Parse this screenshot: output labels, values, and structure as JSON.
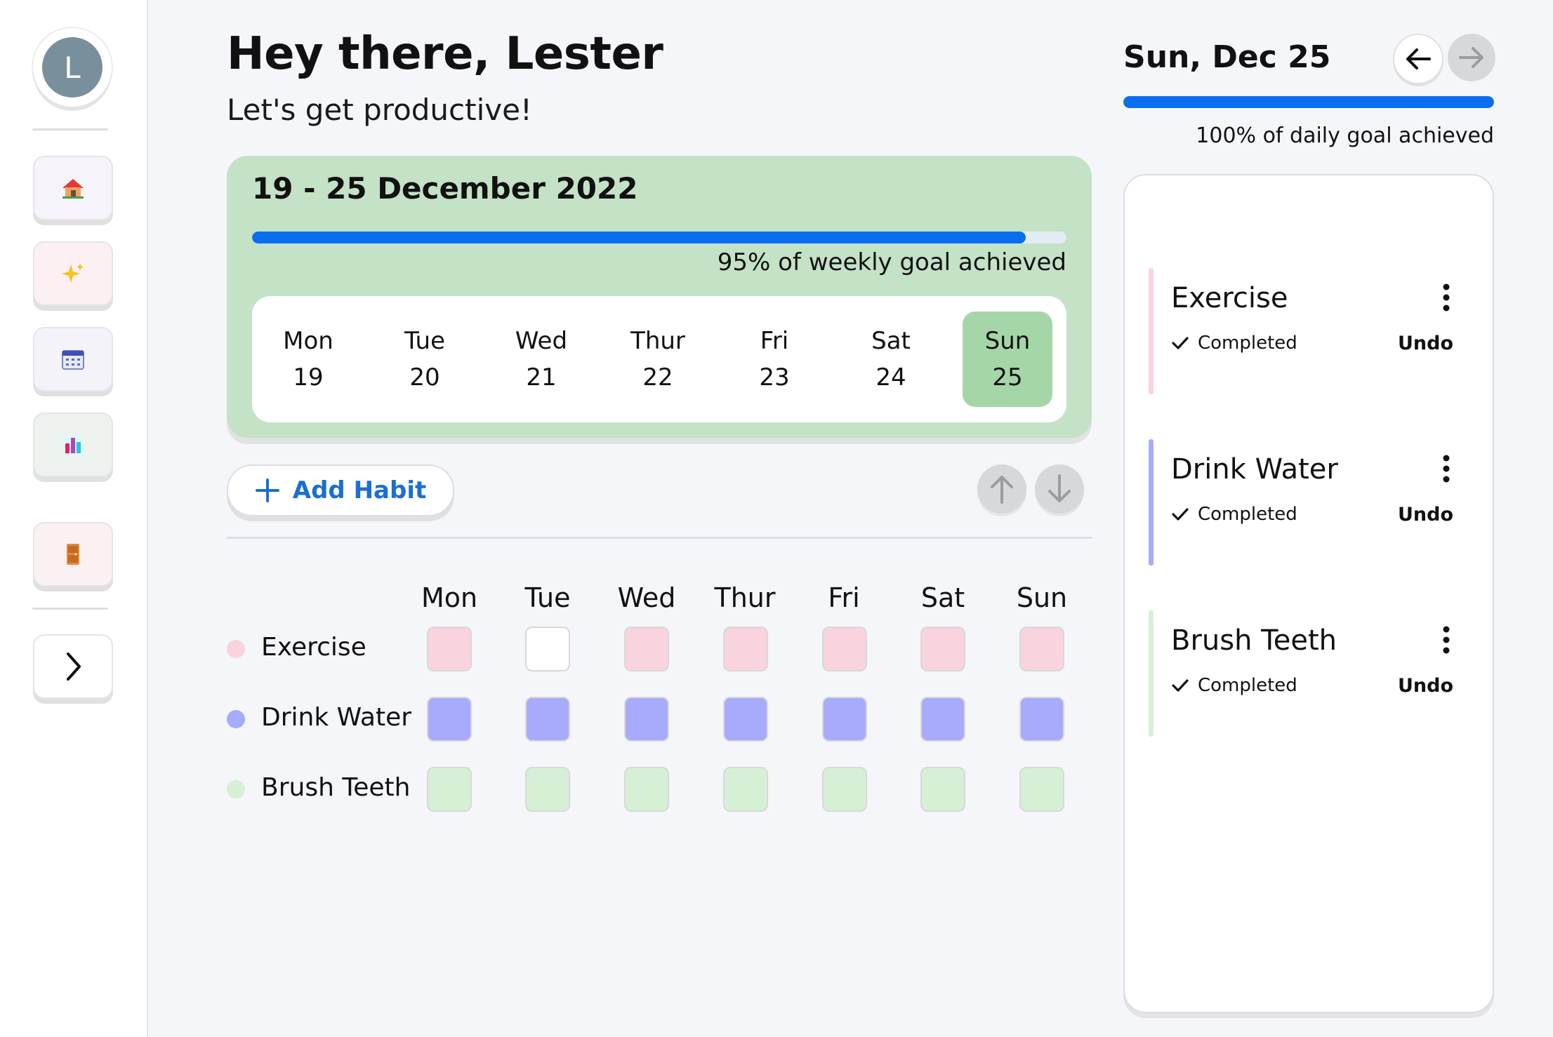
{
  "user": {
    "initial": "L"
  },
  "header": {
    "greeting": "Hey there, Lester",
    "subtitle": "Let's get productive!"
  },
  "week": {
    "title": "19 - 25 December 2022",
    "progress": 0.95,
    "goal_text": "95% of weekly goal achieved",
    "days": [
      {
        "name": "Mon",
        "num": "19"
      },
      {
        "name": "Tue",
        "num": "20"
      },
      {
        "name": "Wed",
        "num": "21"
      },
      {
        "name": "Thur",
        "num": "22"
      },
      {
        "name": "Fri",
        "num": "23"
      },
      {
        "name": "Sat",
        "num": "24"
      },
      {
        "name": "Sun",
        "num": "25"
      }
    ],
    "selected_index": 6
  },
  "actions": {
    "add_habit_label": "Add Habit"
  },
  "grid": {
    "columns": [
      "Mon",
      "Tue",
      "Wed",
      "Thur",
      "Fri",
      "Sat",
      "Sun"
    ],
    "habits": [
      {
        "name": "Exercise",
        "color": "#f9d3de",
        "done": [
          true,
          false,
          true,
          true,
          true,
          true,
          true
        ]
      },
      {
        "name": "Drink Water",
        "color": "#a8aafc",
        "done": [
          true,
          true,
          true,
          true,
          true,
          true,
          true
        ]
      },
      {
        "name": "Brush Teeth",
        "color": "#d6f0d6",
        "done": [
          true,
          true,
          true,
          true,
          true,
          true,
          true
        ]
      }
    ]
  },
  "day_view": {
    "date": "Sun, Dec 25",
    "progress": 1.0,
    "goal_text": "100% of daily goal achieved",
    "tasks": [
      {
        "name": "Exercise",
        "status": "Completed",
        "undo": "Undo",
        "bar_color": "#f9d3de"
      },
      {
        "name": "Drink Water",
        "status": "Completed",
        "undo": "Undo",
        "bar_color": "#a8aafc"
      },
      {
        "name": "Brush Teeth",
        "status": "Completed",
        "undo": "Undo",
        "bar_color": "#d6f0d6"
      }
    ]
  },
  "sidebar": {
    "items": [
      {
        "icon": "home-icon",
        "bg": "#f6f4fa"
      },
      {
        "icon": "sparkles-icon",
        "bg": "#fcf0f3"
      },
      {
        "icon": "calendar-icon",
        "bg": "#f4f3f9"
      },
      {
        "icon": "bar-chart-icon",
        "bg": "#eef2ee"
      },
      {
        "icon": "door-icon",
        "bg": "#fcf1f2"
      }
    ],
    "expand_icon": "chevron-right-icon"
  },
  "colors": {
    "accent": "#0a6ef0",
    "week_card": "#c4e2c6",
    "selected_day": "#a5d6a7",
    "add_habit_text": "#1b6fd1"
  }
}
